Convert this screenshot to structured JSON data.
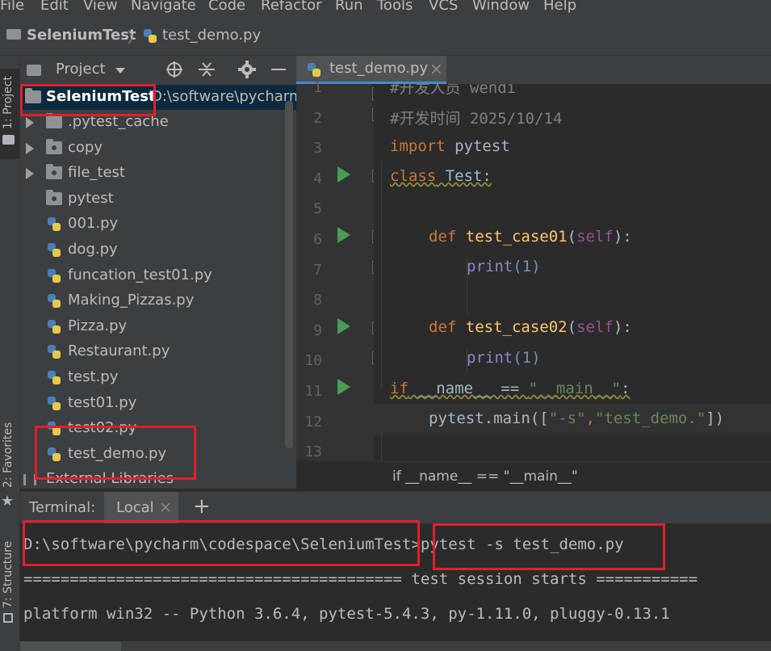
{
  "menu": {
    "items": [
      "File",
      "Edit",
      "View",
      "Navigate",
      "Code",
      "Refactor",
      "Run",
      "Tools",
      "VCS",
      "Window",
      "Help"
    ]
  },
  "nav": {
    "project": "SeleniumTest",
    "sep": "〉",
    "file": "test_demo.py"
  },
  "sidebar": {
    "project_tab": "1: Project",
    "favorites_tab": "2: Favorites",
    "structure_tab": "7: Structure"
  },
  "project_panel": {
    "title": "Project",
    "root_name": "SeleniumTest",
    "root_path": "D:\\software\\pycharm",
    "items": [
      {
        "label": ".pytest_cache",
        "type": "folder",
        "expandable": true
      },
      {
        "label": "copy",
        "type": "package",
        "expandable": true
      },
      {
        "label": "file_test",
        "type": "package",
        "expandable": true
      },
      {
        "label": "pytest",
        "type": "package",
        "expandable": false
      },
      {
        "label": "001.py",
        "type": "py"
      },
      {
        "label": "dog.py",
        "type": "py"
      },
      {
        "label": "funcation_test01.py",
        "type": "py"
      },
      {
        "label": "Making_Pizzas.py",
        "type": "py"
      },
      {
        "label": "Pizza.py",
        "type": "py"
      },
      {
        "label": "Restaurant.py",
        "type": "py"
      },
      {
        "label": "test.py",
        "type": "py"
      },
      {
        "label": "test01.py",
        "type": "py"
      },
      {
        "label": "test02.py",
        "type": "py"
      },
      {
        "label": "test_demo.py",
        "type": "py"
      }
    ],
    "external": "External Libraries"
  },
  "editor": {
    "tab_label": "test_demo.py",
    "close": "×",
    "line_numbers": [
      "1",
      "2",
      "3",
      "4",
      "5",
      "6",
      "7",
      "8",
      "9",
      "10",
      "11",
      "12",
      "13"
    ],
    "code": {
      "l1": "#开发人员 wendi",
      "l2": "#开发时间 2025/10/14",
      "l3_kw": "import",
      "l3_rest": " pytest",
      "l4_kw": "class",
      "l4_rest": " Test:",
      "l6_kw": "def",
      "l6_fn": " test_case01",
      "l6_p1": "(",
      "l6_self": "self",
      "l6_p2": "):",
      "l7_fn": "print",
      "l7_rest": "(1)",
      "l9_kw": "def",
      "l9_fn": " test_case02",
      "l9_p1": "(",
      "l9_self": "self",
      "l9_p2": "):",
      "l10_fn": "print",
      "l10_rest": "(1)",
      "l11_kw": "if",
      "l11_a": " __name__ == ",
      "l11_str": "\"__main__\"",
      "l11_b": ":",
      "l12_a": "pytest.main([",
      "l12_s1": "\"-s\"",
      "l12_c": ",",
      "l12_s2": "\"test_demo.\"",
      "l12_b": "])"
    },
    "breadcrumb": "if __name__ == \"__main__\""
  },
  "terminal": {
    "label": "Terminal:",
    "tab": "Local",
    "close": "×",
    "add": "+",
    "prompt_path": "D:\\software\\pycharm\\codespace\\SeleniumTest",
    "command": ">pytest -s test_demo.py",
    "session_line": "========================================= test session starts ===========",
    "platform_line": "platform win32 -- Python 3.6.4, pytest-5.4.3, py-1.11.0, pluggy-0.13.1"
  },
  "colors": {
    "accent": "#4a88c7",
    "highlight": "#e0202a",
    "keyword": "#cc7832",
    "function": "#ffc66d",
    "string": "#6a8759",
    "comment": "#808080",
    "number": "#6897bb",
    "builtin": "#8888c6",
    "self": "#94558d",
    "run": "#499c54"
  }
}
